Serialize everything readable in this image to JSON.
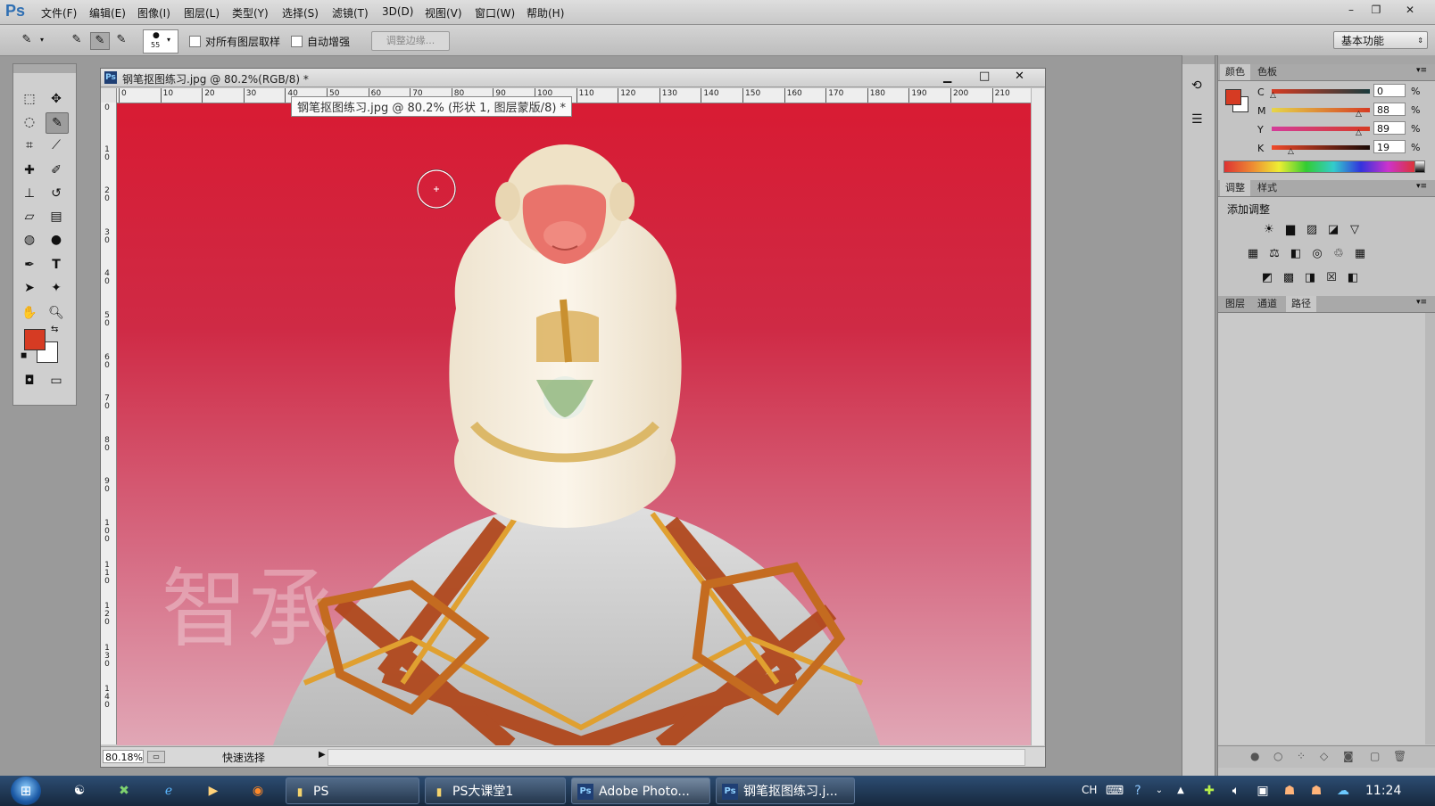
{
  "menubar": {
    "logo": "Ps",
    "items": [
      "文件(F)",
      "编辑(E)",
      "图像(I)",
      "图层(L)",
      "类型(Y)",
      "选择(S)",
      "滤镜(T)",
      "3D(D)",
      "视图(V)",
      "窗口(W)",
      "帮助(H)"
    ],
    "window_controls": {
      "minimize": "–",
      "restore": "❐",
      "close": "✕"
    }
  },
  "options": {
    "brush_size": "55",
    "sample_all_layers": "对所有图层取样",
    "auto_enhance": "自动增强",
    "refine_edge": "调整边缘...",
    "workspace": "基本功能"
  },
  "document": {
    "title": "钢笔抠图练习.jpg @ 80.2%(RGB/8) *",
    "tooltip": "钢笔抠图练习.jpg @ 80.2% (形状 1, 图层蒙版/8) *",
    "zoom": "80.18%",
    "status_mode": "快速选择",
    "ruler_h": [
      "0",
      "10",
      "20",
      "30",
      "40",
      "50",
      "60",
      "70",
      "80",
      "90",
      "100",
      "110",
      "120",
      "130",
      "140",
      "150",
      "160",
      "170",
      "180",
      "190",
      "200",
      "210"
    ],
    "ruler_v": [
      "0",
      "1 0",
      "2 0",
      "3 0",
      "4 0",
      "5 0",
      "6 0",
      "7 0",
      "8 0",
      "9 0",
      "1 0 0",
      "1 1 0",
      "1 2 0",
      "1 3 0",
      "1 4 0"
    ],
    "controls": {
      "minimize": "▁",
      "maximize": "□",
      "close": "✕"
    },
    "watermark": "智承"
  },
  "color_panel": {
    "tabs": [
      "颜色",
      "色板"
    ],
    "channels": [
      {
        "label": "C",
        "value": "0"
      },
      {
        "label": "M",
        "value": "88"
      },
      {
        "label": "Y",
        "value": "89"
      },
      {
        "label": "K",
        "value": "19"
      }
    ],
    "percent": "%",
    "foreground": "#d63b23",
    "background": "#ffffff"
  },
  "adjust_panel": {
    "tabs": [
      "调整",
      "样式"
    ],
    "heading": "添加调整"
  },
  "layers_panel": {
    "tabs": [
      "图层",
      "通道",
      "路径"
    ]
  },
  "taskbar": {
    "tasks": [
      "PS",
      "PS大课堂1",
      "Adobe Photo...",
      "钢笔抠图练习.j..."
    ],
    "lang": "CH",
    "clock": "11:24"
  }
}
